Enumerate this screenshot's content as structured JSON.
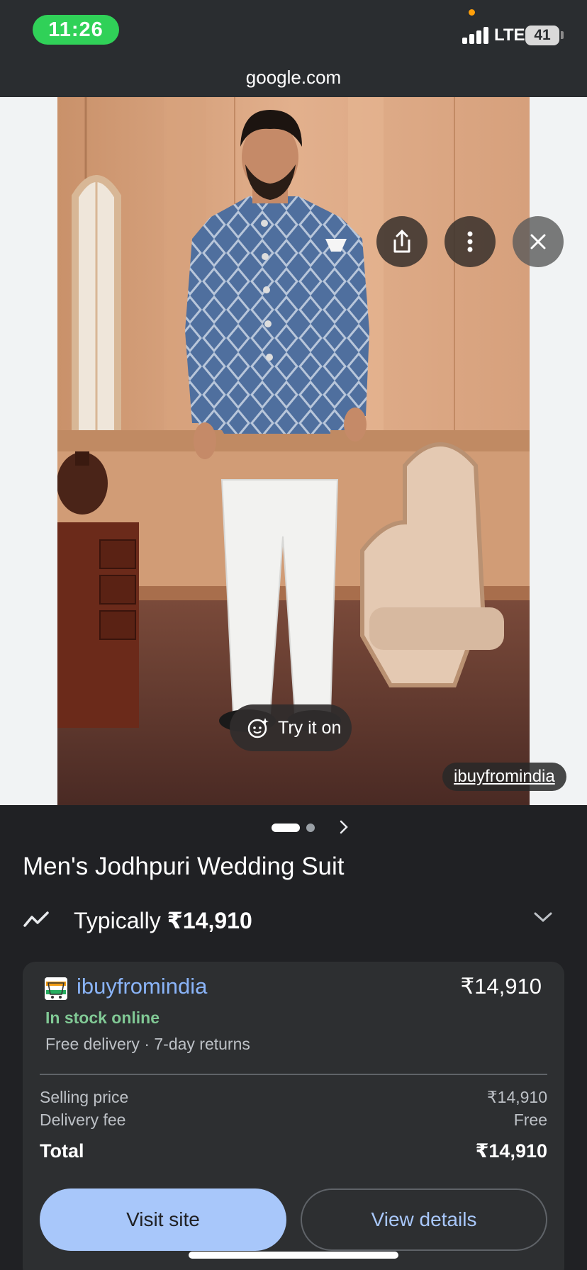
{
  "status_bar": {
    "time": "11:26",
    "network": "LTE",
    "battery": "41"
  },
  "browser": {
    "url": "google.com"
  },
  "image_viewer": {
    "try_on_label": "Try it on",
    "source": "ibuyfromindia",
    "carousel": {
      "count": 2,
      "active": 1
    }
  },
  "product": {
    "title": "Men's Jodhpuri Wedding Suit",
    "typical_prefix": "Typically ",
    "typical_price": "₹14,910"
  },
  "offer": {
    "store": "ibuyfromindia",
    "price": "₹14,910",
    "stock": "In stock online",
    "delivery": "Free delivery · 7-day returns",
    "selling_price_label": "Selling price",
    "selling_price": "₹14,910",
    "delivery_fee_label": "Delivery fee",
    "delivery_fee": "Free",
    "total_label": "Total",
    "total": "₹14,910",
    "visit_label": "Visit site",
    "details_label": "View details"
  },
  "icons": [
    "share-icon",
    "more-vert-icon",
    "close-icon",
    "sparkle-face-icon",
    "trend-icon",
    "chevron-down-icon",
    "chevron-right-icon",
    "store-favicon"
  ],
  "colors": {
    "link": "#8ab4f8",
    "in_stock": "#81c995",
    "primary_button": "#a8c7fa",
    "time_pill": "#30d158"
  }
}
